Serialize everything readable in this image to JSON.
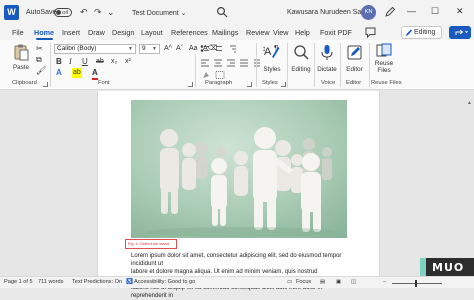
{
  "titlebar": {
    "app_logo": "W",
    "autosave_label": "AutoSave",
    "autosave_state": "Off",
    "undo_icon": "↶",
    "redo_icon": "↷",
    "customize_icon": "⌄",
    "document_title": "Test Document",
    "document_title_chevron": "⌄",
    "user_name": "Kawusara Nurudeen Salley",
    "user_initials": "KN",
    "minimize": "—",
    "maximize": "☐",
    "close": "✕"
  },
  "tabs": [
    "File",
    "Home",
    "Insert",
    "Draw",
    "Design",
    "Layout",
    "References",
    "Mailings",
    "Review",
    "View",
    "Help",
    "Foxit PDF"
  ],
  "active_tab": "Home",
  "editing_mode": {
    "label": "Editing",
    "chevron": "⌄"
  },
  "ribbon": {
    "clipboard": {
      "paste_label": "Paste",
      "group_label": "Clipboard"
    },
    "font": {
      "font_name": "Calibri (Body)",
      "font_size": "9",
      "group_label": "Font",
      "grow": "A^",
      "shrink": "Aˇ",
      "case": "Aa",
      "clear": "A⌫",
      "bold": "B",
      "italic": "I",
      "underline": "U",
      "strike": "ab",
      "subscript": "x₂",
      "superscript": "x²",
      "effects": "A",
      "highlight": "ab",
      "color": "A"
    },
    "paragraph": {
      "group_label": "Paragraph",
      "sort": "↕",
      "show_marks": "¶"
    },
    "styles": {
      "label": "Styles",
      "group_label": "Styles"
    },
    "editing": {
      "label": "Editing"
    },
    "voice": {
      "label": "Dictate",
      "group_label": "Voice"
    },
    "editor": {
      "label": "Editor",
      "group_label": "Editor"
    },
    "reuse": {
      "label": "Reuse Files",
      "group_label": "Reuse Files"
    },
    "collapse_icon": "⌃"
  },
  "document": {
    "caption": "Fig. 1: United we stand",
    "body_lines": [
      "Lorem ipsum dolor sit amet, consectetur adipiscing elit, sed do eiusmod tempor incididunt ut",
      "labore et dolore magna aliqua. Ut enim ad minim veniam, quis nostrud exercitation ullamco",
      "laboris nisi ut aliquip ex ea commodo consequat. Duis aute irure dolor in reprehenderit in"
    ]
  },
  "statusbar": {
    "page": "Page 1 of 5",
    "words": "711 words",
    "predictions": "Text Predictions: On",
    "accessibility": "Accessibility: Good to go",
    "focus": "Focus",
    "zoom_out": "−"
  },
  "watermark": "MUO",
  "colors": {
    "accent": "#185abd",
    "caption_border": "#e05050"
  }
}
